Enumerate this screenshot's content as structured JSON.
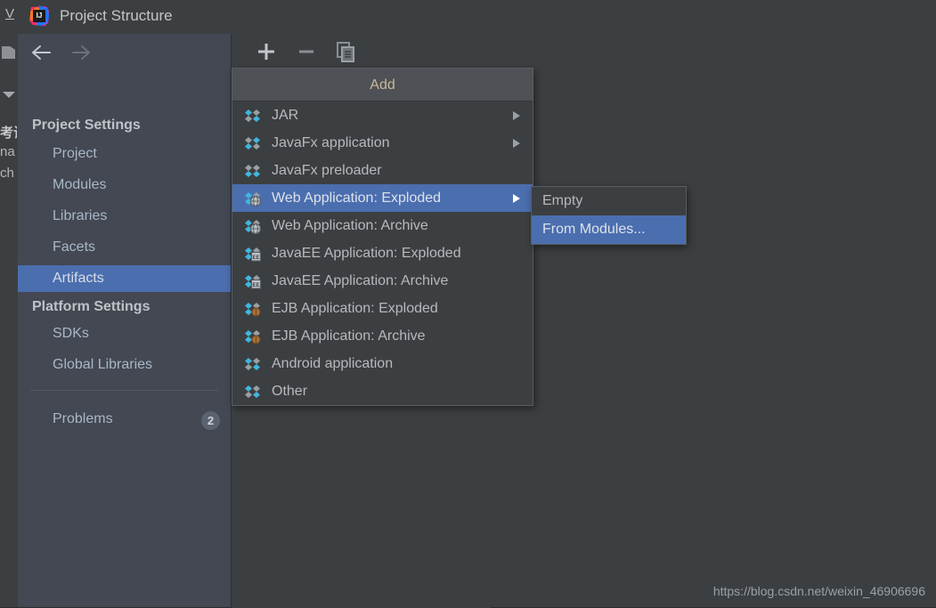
{
  "ide": {
    "menu_v": "V",
    "side_text_1": "考试",
    "side_text_2": "na",
    "side_text_3": "ch"
  },
  "dialog": {
    "title": "Project Structure",
    "icon": "intellij-idea-logo",
    "nav_back_icon": "arrow-left-icon",
    "nav_forward_icon": "arrow-right-icon"
  },
  "sidebar": {
    "sections": [
      {
        "label": "Project Settings"
      },
      {
        "label": "Platform Settings"
      }
    ],
    "project_settings_items": [
      {
        "label": "Project",
        "selected": false
      },
      {
        "label": "Modules",
        "selected": false
      },
      {
        "label": "Libraries",
        "selected": false
      },
      {
        "label": "Facets",
        "selected": false
      },
      {
        "label": "Artifacts",
        "selected": true
      }
    ],
    "platform_settings_items": [
      {
        "label": "SDKs",
        "selected": false
      },
      {
        "label": "Global Libraries",
        "selected": false
      }
    ],
    "problems": {
      "label": "Problems",
      "count": "2"
    }
  },
  "toolbar": {
    "add_label": "+",
    "remove_label": "−",
    "copy_label": "copy-icon"
  },
  "add_menu": {
    "header": "Add",
    "items": [
      {
        "label": "JAR",
        "icon": "artifact-diamond-icon",
        "submenu": true,
        "selected": false
      },
      {
        "label": "JavaFx application",
        "icon": "artifact-diamond-icon",
        "submenu": true,
        "selected": false
      },
      {
        "label": "JavaFx preloader",
        "icon": "artifact-diamond-icon",
        "submenu": false,
        "selected": false
      },
      {
        "label": "Web Application: Exploded",
        "icon": "artifact-web-icon",
        "submenu": true,
        "selected": true
      },
      {
        "label": "Web Application: Archive",
        "icon": "artifact-web-icon",
        "submenu": false,
        "selected": false
      },
      {
        "label": "JavaEE Application: Exploded",
        "icon": "artifact-javaee-icon",
        "submenu": false,
        "selected": false
      },
      {
        "label": "JavaEE Application: Archive",
        "icon": "artifact-javaee-icon",
        "submenu": false,
        "selected": false
      },
      {
        "label": "EJB Application: Exploded",
        "icon": "artifact-ejb-icon",
        "submenu": false,
        "selected": false
      },
      {
        "label": "EJB Application: Archive",
        "icon": "artifact-ejb-icon",
        "submenu": false,
        "selected": false
      },
      {
        "label": "Android application",
        "icon": "artifact-diamond-icon",
        "submenu": false,
        "selected": false
      },
      {
        "label": "Other",
        "icon": "artifact-diamond-icon",
        "submenu": false,
        "selected": false
      }
    ]
  },
  "sub_menu": {
    "items": [
      {
        "label": "Empty",
        "selected": false
      },
      {
        "label": "From Modules...",
        "selected": true
      }
    ]
  },
  "watermark": "https://blog.csdn.net/weixin_46906696",
  "colors": {
    "accent_selection": "#4b6eaf",
    "dialog_bg": "#3c3f41",
    "nav_bg": "#434853",
    "menu_header_bg": "#4e5155",
    "text": "#b6b9bd",
    "icon_cyan": "#40b6e0",
    "icon_gray": "#9aa0a6"
  }
}
